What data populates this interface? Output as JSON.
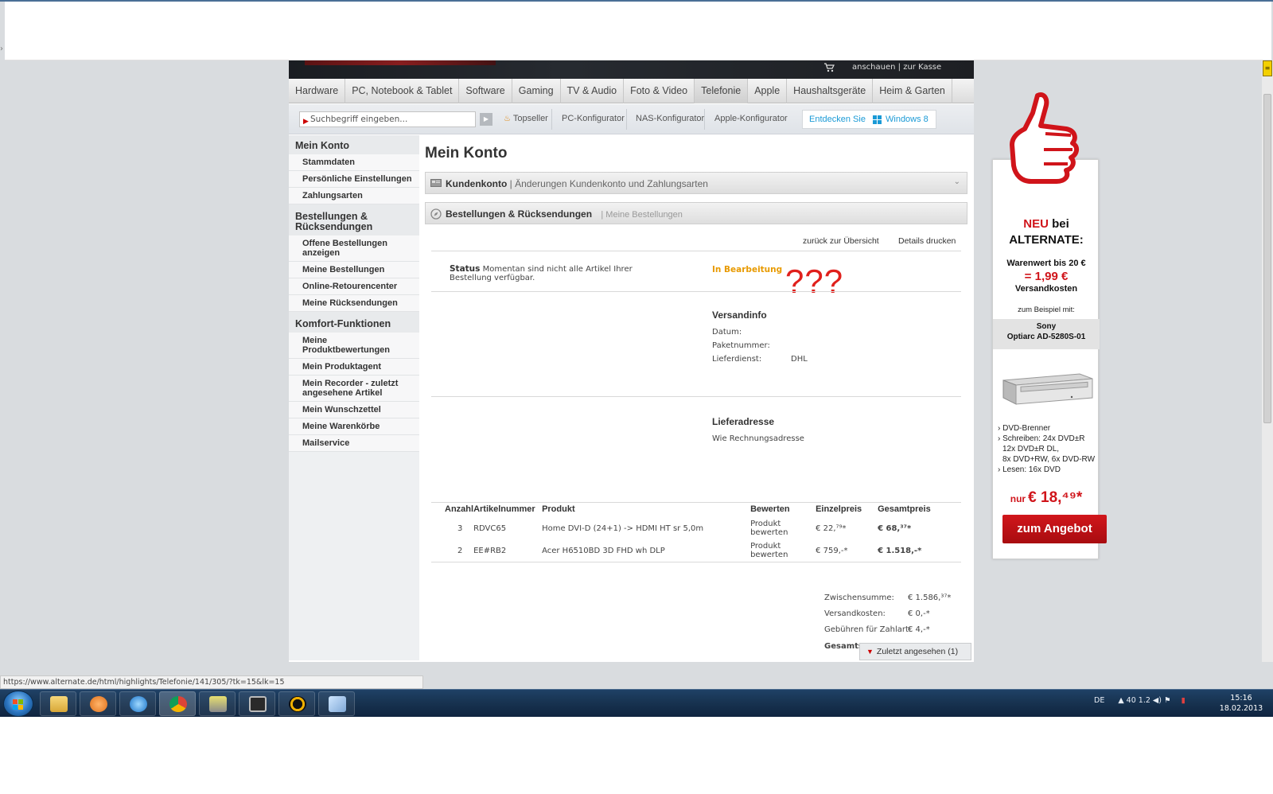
{
  "header": {
    "cart_links": "anschauen | zur Kasse"
  },
  "nav": {
    "tabs": [
      {
        "label": "Hardware"
      },
      {
        "label": "PC, Notebook & Tablet"
      },
      {
        "label": "Software"
      },
      {
        "label": "Gaming"
      },
      {
        "label": "TV & Audio"
      },
      {
        "label": "Foto & Video"
      },
      {
        "label": "Telefonie",
        "active": true
      },
      {
        "label": "Apple"
      },
      {
        "label": "Haushaltsgeräte"
      },
      {
        "label": "Heim & Garten"
      }
    ]
  },
  "subbar": {
    "search_placeholder": "Suchbegriff eingeben...",
    "topseller": "Topseller",
    "pc_konfigurator": "PC-Konfigurator",
    "nas_konfigurator": "NAS-Konfigurator",
    "apple_konfigurator": "Apple-Konfigurator",
    "win8_prefix": "Entdecken Sie",
    "win8_label": "Windows 8"
  },
  "sidebar": {
    "sections": [
      {
        "title": "Mein Konto",
        "items": [
          "Stammdaten",
          "Persönliche Einstellungen",
          "Zahlungsarten"
        ]
      },
      {
        "title": "Bestellungen & Rücksendungen",
        "items": [
          "Offene Bestellungen anzeigen",
          "Meine Bestellungen",
          "Online-Retourencenter",
          "Meine Rücksendungen"
        ]
      },
      {
        "title": "Komfort-Funktionen",
        "items": [
          "Meine Produktbewertungen",
          "Mein Produktagent",
          "Mein Recorder - zuletzt angesehene Artikel",
          "Mein Wunschzettel",
          "Meine Warenkörbe",
          "Mailservice"
        ]
      }
    ]
  },
  "content": {
    "title": "Mein Konto",
    "panel1": {
      "title": "Kundenkonto",
      "subtitle": "| Änderungen Kundenkonto und Zahlungsarten"
    },
    "panel2": {
      "title": "Bestellungen & Rücksendungen",
      "subtitle": "| Meine Bestellungen"
    },
    "back_link": "zurück zur Übersicht",
    "print_link": "Details drucken",
    "status": {
      "label": "Status",
      "text": "Momentan sind nicht alle Artikel Ihrer Bestellung verfügbar.",
      "value": "In Bearbeitung",
      "annotation": "???"
    },
    "versandinfo": {
      "title": "Versandinfo",
      "datum_label": "Datum:",
      "datum_value": "",
      "paket_label": "Paketnummer:",
      "paket_value": "",
      "dienst_label": "Lieferdienst:",
      "dienst_value": "DHL"
    },
    "lieferadresse": {
      "title": "Lieferadresse",
      "value": "Wie Rechnungsadresse"
    },
    "table": {
      "headers": [
        "Anzahl",
        "Artikelnummer",
        "Produkt",
        "Bewerten",
        "Einzelpreis",
        "Gesamtpreis"
      ],
      "rows": [
        {
          "qty": "3",
          "sku": "RDVC65",
          "product": "Home DVI-D (24+1) -> HDMI HT sr 5,0m",
          "rate": "Produkt bewerten",
          "unit": "€ 22,⁷⁹*",
          "total": "€ 68,³⁷*"
        },
        {
          "qty": "2",
          "sku": "EE#RB2",
          "product": "Acer H6510BD 3D FHD wh DLP",
          "rate": "Produkt bewerten",
          "unit": "€ 759,-*",
          "total": "€ 1.518,-*"
        }
      ]
    },
    "summary": {
      "zwischensumme_label": "Zwischensumme:",
      "zwischensumme_value": "€ 1.586,³⁷*",
      "versand_label": "Versandkosten:",
      "versand_value": "€ 0,-*",
      "gebuehren_label": "Gebühren für Zahlart:",
      "gebuehren_value": "€ 4,-*",
      "gesamt_label": "Gesamtsumme:"
    },
    "recent_label": "Zuletzt angesehen (1)"
  },
  "ad": {
    "neu": "NEU",
    "bei": "bei",
    "brand": "ALTERNATE:",
    "warenwert": "Warenwert bis 20 €",
    "price": "= 1,99 €",
    "versandkosten": "Versandkosten",
    "beispiel": "zum Beispiel mit:",
    "product_brand": "Sony",
    "product_name": "Optiarc AD-5280S-01",
    "bullets": [
      "› DVD-Brenner",
      "› Schreiben: 24x DVD±R",
      "12x DVD±R DL,",
      "8x DVD+RW, 6x DVD-RW",
      "› Lesen: 16x DVD"
    ],
    "nur": "nur",
    "offer_price": "€ 18,⁴⁹*",
    "cta": "zum Angebot"
  },
  "browser": {
    "status_url": "https://www.alternate.de/html/highlights/Telefonie/141/305/?tk=15&lk=15"
  },
  "taskbar": {
    "lang": "DE",
    "tray_text": "▲  40  1.2  ◀)  ⚑",
    "time": "15:16",
    "date": "18.02.2013"
  },
  "colors": {
    "accent_red": "#c8101b",
    "status_orange": "#e89a00",
    "win_blue": "#1a9ad6"
  }
}
